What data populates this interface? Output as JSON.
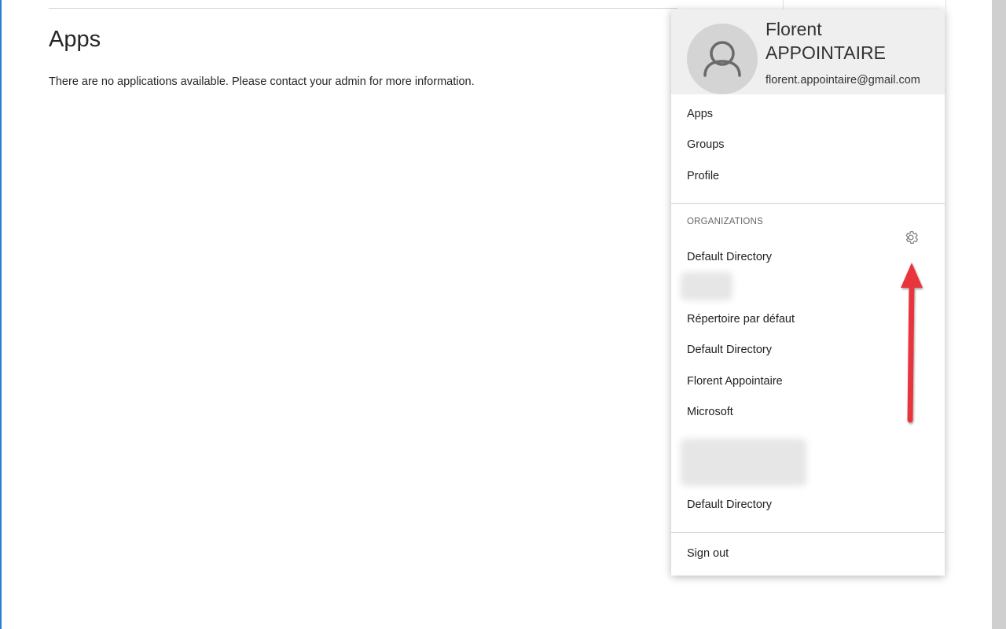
{
  "page": {
    "title": "Apps",
    "message": "There are no applications available. Please contact your admin for more information."
  },
  "account_menu": {
    "user": {
      "first_name": "Florent",
      "last_name": "APPOINTAIRE",
      "email": "florent.appointaire@gmail.com",
      "avatar_icon": "person-icon"
    },
    "nav_items": [
      {
        "label": "Apps"
      },
      {
        "label": "Groups"
      },
      {
        "label": "Profile"
      }
    ],
    "organizations_heading": "ORGANIZATIONS",
    "settings_icon": "gear-icon",
    "organizations": [
      {
        "label": "Default Directory"
      },
      {
        "label": "Répertoire par défaut"
      },
      {
        "label": "Default Directory"
      },
      {
        "label": "Florent Appointaire"
      },
      {
        "label": "Microsoft"
      },
      {
        "label": "Default Directory"
      }
    ],
    "sign_out_label": "Sign out"
  },
  "annotation": {
    "arrow_color": "#e8363e"
  },
  "colors": {
    "header_bg": "#efefef",
    "window_accent": "#2b7cd3"
  }
}
